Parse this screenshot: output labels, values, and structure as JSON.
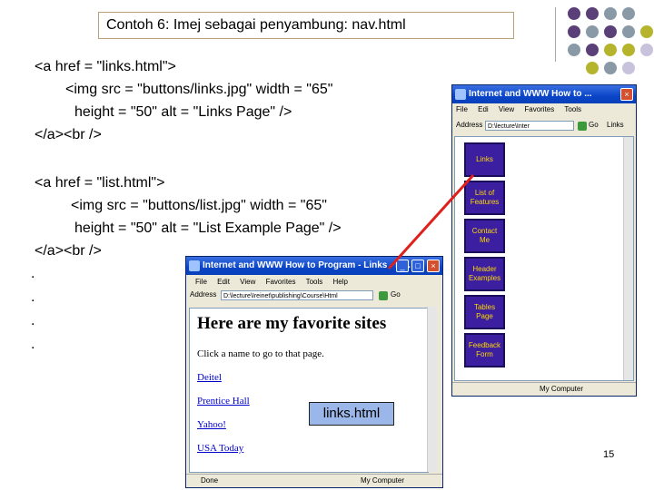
{
  "slide": {
    "title": "Contoh 6: Imej sebagai penyambung: nav.html",
    "code_lines": [
      "<a href = \"links.html\">",
      "<img src = \"buttons/links.jpg\" width = \"65\"",
      "height = \"50\" alt = \"Links Page\" />",
      "</a><br />",
      "<a href = \"list.html\">",
      "<img src = \"buttons/list.jpg\" width = \"65\"",
      "height = \"50\" alt = \"List Example Page\" />",
      "</a><br />"
    ],
    "ellipsis": [
      ".",
      ".",
      ".",
      "."
    ],
    "callout_label": "links.html",
    "page_number": "15",
    "colors": {
      "purple": "#5b3f78",
      "gray": "#8a99a6",
      "olive": "#b5b42c",
      "lavender": "#c9c2dc",
      "arrow": "#e0201c"
    }
  },
  "nav_window": {
    "title": "Internet and WWW How to ...",
    "menu": [
      "File",
      "Edi",
      "View",
      "Favorites",
      "Tools"
    ],
    "address_label": "Address",
    "address_value": "D:\\lecture\\Inter",
    "go": "Go",
    "links_label": "Links",
    "buttons": [
      "Links",
      "List of Features",
      "Contact Me",
      "Header Examples",
      "Tables Page",
      "Feedback Form"
    ],
    "status_right": "My Computer"
  },
  "links_window": {
    "title": "Internet and WWW How to Program - Links - M...",
    "menu": [
      "File",
      "Edit",
      "View",
      "Favorites",
      "Tools",
      "Help"
    ],
    "address_label": "Address",
    "address_value": "D:\\lecture\\Ireinet\\publishing\\Course\\Html",
    "go": "Go",
    "heading": "Here are my favorite sites",
    "subtext": "Click a name to go to that page.",
    "links": [
      "Deitel",
      "Prentice Hall",
      "Yahoo!",
      "USA Today"
    ],
    "status_left": "Done",
    "status_right": "My Computer"
  }
}
